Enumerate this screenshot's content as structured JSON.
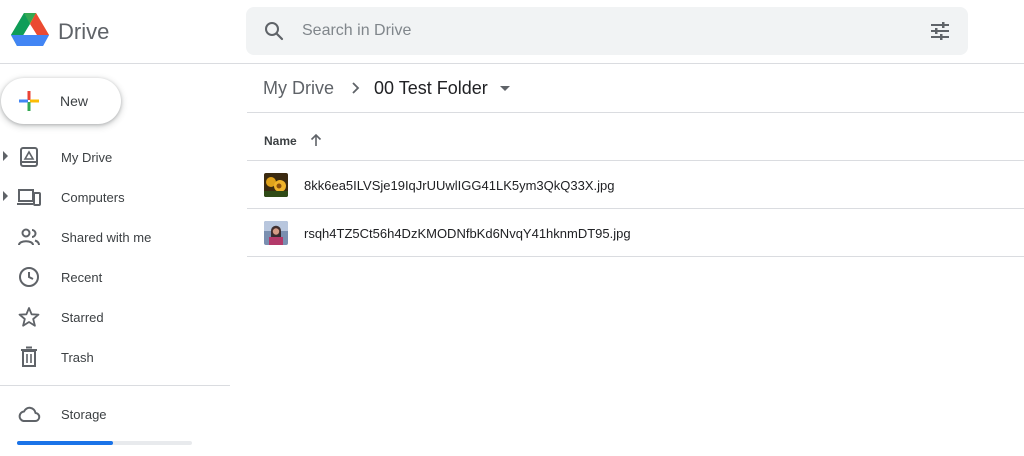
{
  "header": {
    "app_name": "Drive",
    "search_placeholder": "Search in Drive"
  },
  "sidebar": {
    "new_label": "New",
    "items": [
      {
        "label": "My Drive",
        "icon": "my-drive-icon",
        "expandable": true
      },
      {
        "label": "Computers",
        "icon": "computers-icon",
        "expandable": true
      },
      {
        "label": "Shared with me",
        "icon": "shared-icon",
        "expandable": false
      },
      {
        "label": "Recent",
        "icon": "clock-icon",
        "expandable": false
      },
      {
        "label": "Starred",
        "icon": "star-icon",
        "expandable": false
      },
      {
        "label": "Trash",
        "icon": "trash-icon",
        "expandable": false
      }
    ],
    "storage_label": "Storage",
    "storage_used_fraction": 0.55
  },
  "breadcrumb": {
    "root": "My Drive",
    "current": "00 Test Folder"
  },
  "file_list": {
    "column_name": "Name",
    "sort": "ascending",
    "files": [
      {
        "name": "8kk6ea5ILVSje19IqJrUUwlIGG41LK5ym3QkQ33X.jpg",
        "thumbnail": "flower-photo"
      },
      {
        "name": "rsqh4TZ5Ct56h4DzKMODNfbKd6NvqY41hknmDT95.jpg",
        "thumbnail": "person-photo"
      }
    ]
  },
  "colors": {
    "accent": "#1a73e8",
    "border": "#dadce0",
    "search_bg": "#f1f3f4"
  }
}
